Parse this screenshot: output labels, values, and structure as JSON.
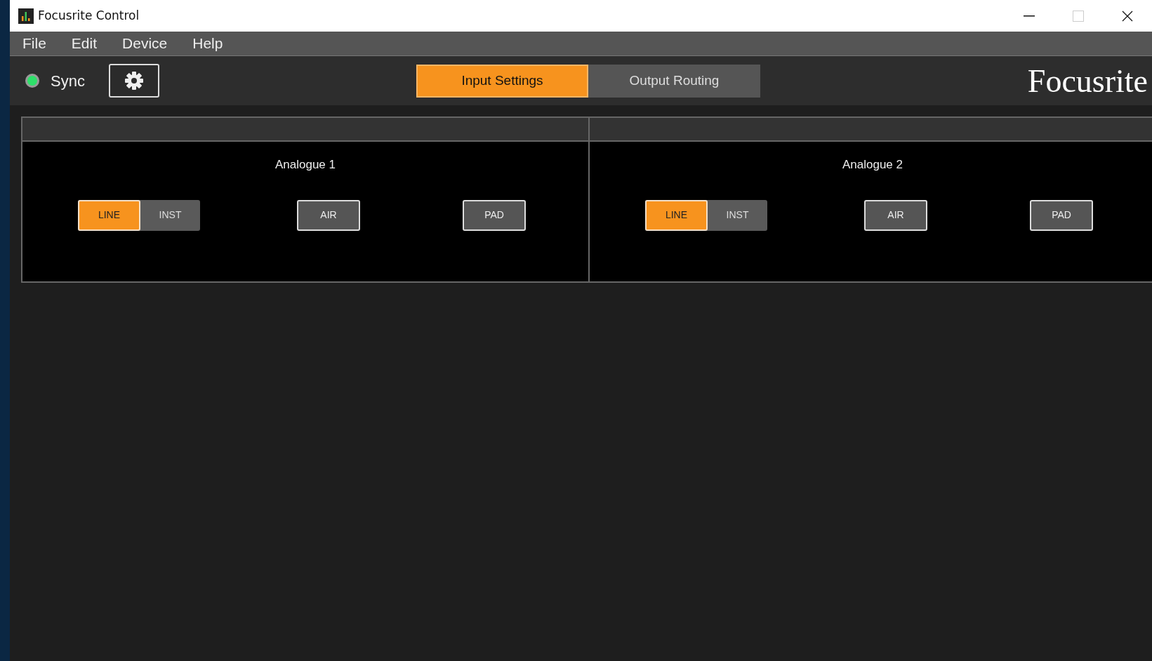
{
  "window": {
    "title": "Focusrite Control"
  },
  "menu": [
    "File",
    "Edit",
    "Device",
    "Help"
  ],
  "sync": {
    "label": "Sync",
    "on": true
  },
  "tabs": [
    {
      "label": "Input Settings",
      "selected": true
    },
    {
      "label": "Output Routing",
      "selected": false
    }
  ],
  "logo": "Focusrite",
  "channels": [
    {
      "name": "Analogue 1",
      "modes": [
        {
          "label": "LINE",
          "selected": true
        },
        {
          "label": "INST",
          "selected": false
        }
      ],
      "toggles": [
        {
          "label": "AIR",
          "on": false
        },
        {
          "label": "PAD",
          "on": false
        }
      ]
    },
    {
      "name": "Analogue 2",
      "modes": [
        {
          "label": "LINE",
          "selected": true
        },
        {
          "label": "INST",
          "selected": false
        }
      ],
      "toggles": [
        {
          "label": "AIR",
          "on": false
        },
        {
          "label": "PAD",
          "on": false
        }
      ]
    }
  ]
}
